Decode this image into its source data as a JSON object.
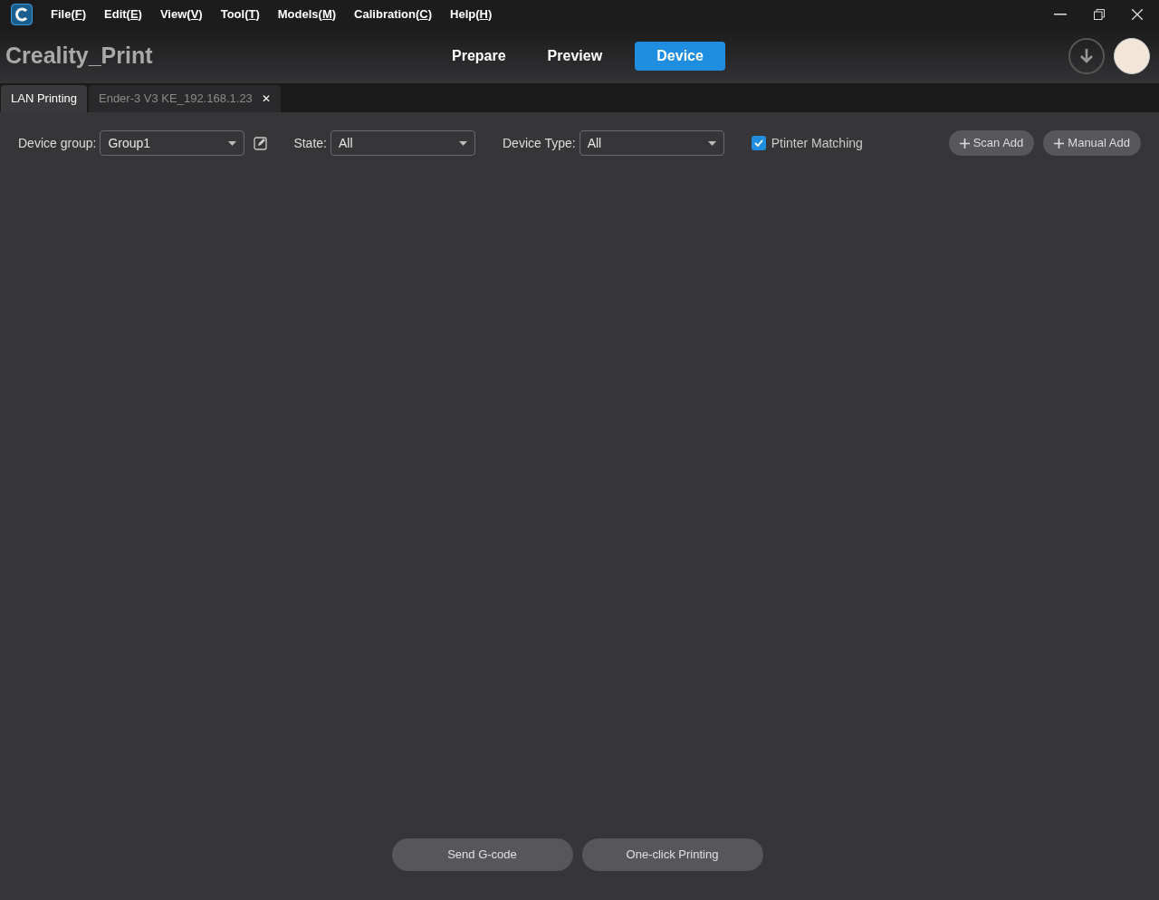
{
  "menu": [
    {
      "before": "File(",
      "key": "F",
      "after": ")"
    },
    {
      "before": "Edit(",
      "key": "E",
      "after": ")"
    },
    {
      "before": "View(",
      "key": "V",
      "after": ")"
    },
    {
      "before": "Tool(",
      "key": "T",
      "after": ")"
    },
    {
      "before": "Models(",
      "key": "M",
      "after": ")"
    },
    {
      "before": "Calibration(",
      "key": "C",
      "after": ")"
    },
    {
      "before": "Help(",
      "key": "H",
      "after": ")"
    }
  ],
  "app_title": "Creality_Print",
  "modes": [
    {
      "label": "Prepare",
      "selected": false
    },
    {
      "label": "Preview",
      "selected": false
    },
    {
      "label": "Device",
      "selected": true
    }
  ],
  "tabs": [
    {
      "label": "LAN Printing",
      "selected": true
    },
    {
      "label": "Ender-3 V3 KE_192.168.1.23",
      "selected": false,
      "close_glyph": "✕"
    }
  ],
  "filters": {
    "group_label": "Device group:",
    "group_value": "Group1",
    "state_label": "State:",
    "state_value": "All",
    "type_label": "Device Type:",
    "type_value": "All",
    "matching_label": "Ptinter Matching",
    "matching_checked": true
  },
  "add_buttons": [
    "Scan Add",
    "Manual Add"
  ],
  "bottom_buttons": [
    "Send G-code",
    "One-click Printing"
  ]
}
